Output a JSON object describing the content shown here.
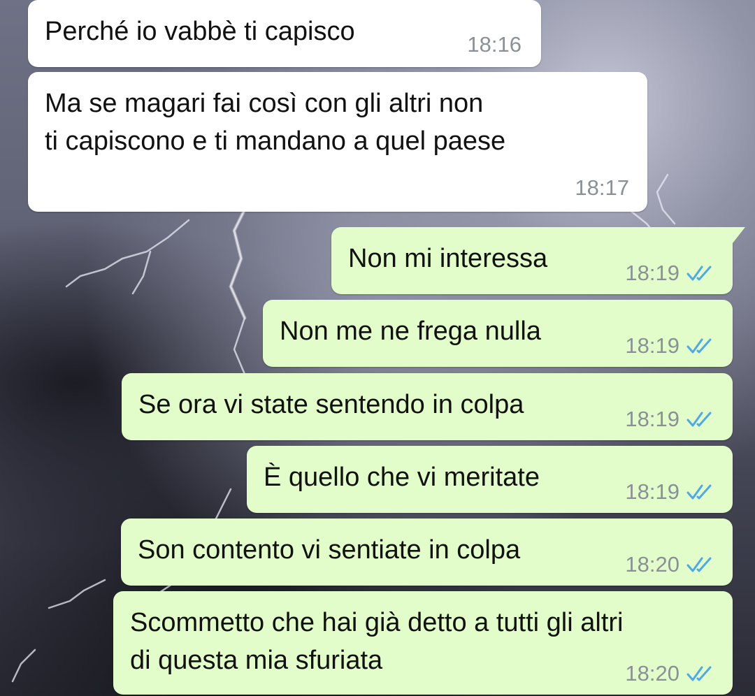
{
  "conversation": {
    "messages": [
      {
        "text": "Perché io vabbè ti capisco",
        "time": "18:16",
        "direction": "incoming"
      },
      {
        "text": "Ma se magari fai così con gli altri non\nti capiscono e ti mandano a quel paese",
        "time": "18:17",
        "direction": "incoming"
      },
      {
        "text": "Non mi interessa",
        "time": "18:19",
        "direction": "outgoing",
        "status_icon": "double-check-read-icon"
      },
      {
        "text": "Non me ne frega nulla",
        "time": "18:19",
        "direction": "outgoing",
        "status_icon": "double-check-read-icon"
      },
      {
        "text": "Se ora vi state sentendo in colpa",
        "time": "18:19",
        "direction": "outgoing",
        "status_icon": "double-check-read-icon"
      },
      {
        "text": "È quello che vi meritate",
        "time": "18:19",
        "direction": "outgoing",
        "status_icon": "double-check-read-icon"
      },
      {
        "text": "Son contento vi sentiate in colpa",
        "time": "18:20",
        "direction": "outgoing",
        "status_icon": "double-check-read-icon"
      },
      {
        "text": "Scommetto che hai già detto a tutti gli altri\ndi questa mia sfuriata",
        "time": "18:20",
        "direction": "outgoing",
        "status_icon": "double-check-read-icon"
      }
    ]
  },
  "colors": {
    "incoming_bubble": "#ffffff",
    "outgoing_bubble": "#e2fdc9",
    "read_checks": "#4fa8ea",
    "timestamp": "#8a9196"
  }
}
